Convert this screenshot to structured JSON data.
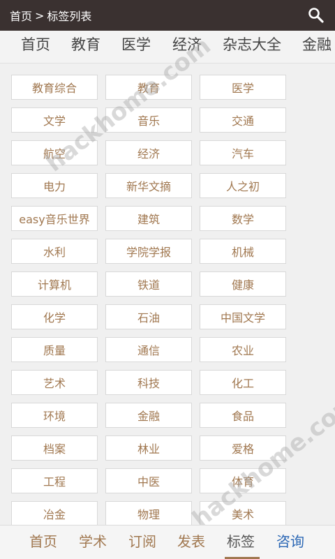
{
  "header": {
    "breadcrumb_home": "首页",
    "breadcrumb_sep": ">",
    "breadcrumb_current": "标签列表",
    "search_icon": "search-icon"
  },
  "categories": [
    "首页",
    "教育",
    "医学",
    "经济",
    "杂志大全",
    "金融"
  ],
  "tags": [
    "教育综合",
    "教育",
    "医学",
    "文学",
    "音乐",
    "交通",
    "航空",
    "经济",
    "汽车",
    "电力",
    "新华文摘",
    "人之初",
    "easy音乐世界",
    "建筑",
    "数学",
    "水利",
    "学院学报",
    "机械",
    "计算机",
    "铁道",
    "健康",
    "化学",
    "石油",
    "中国文学",
    "质量",
    "通信",
    "农业",
    "艺术",
    "科技",
    "化工",
    "环境",
    "金融",
    "食品",
    "档案",
    "林业",
    "爱格",
    "工程",
    "中医",
    "体育",
    "冶金",
    "物理",
    "美术"
  ],
  "bottom_nav": {
    "home": "首页",
    "academic": "学术",
    "subscribe": "订阅",
    "publish": "发表",
    "tags": "标签",
    "consult": "咨询"
  },
  "watermark": "hackhome.com",
  "colors": {
    "topbar": "#3a3130",
    "tag_text": "#a0774f",
    "active_underline": "#a0774f",
    "consult": "#2a66b4"
  }
}
